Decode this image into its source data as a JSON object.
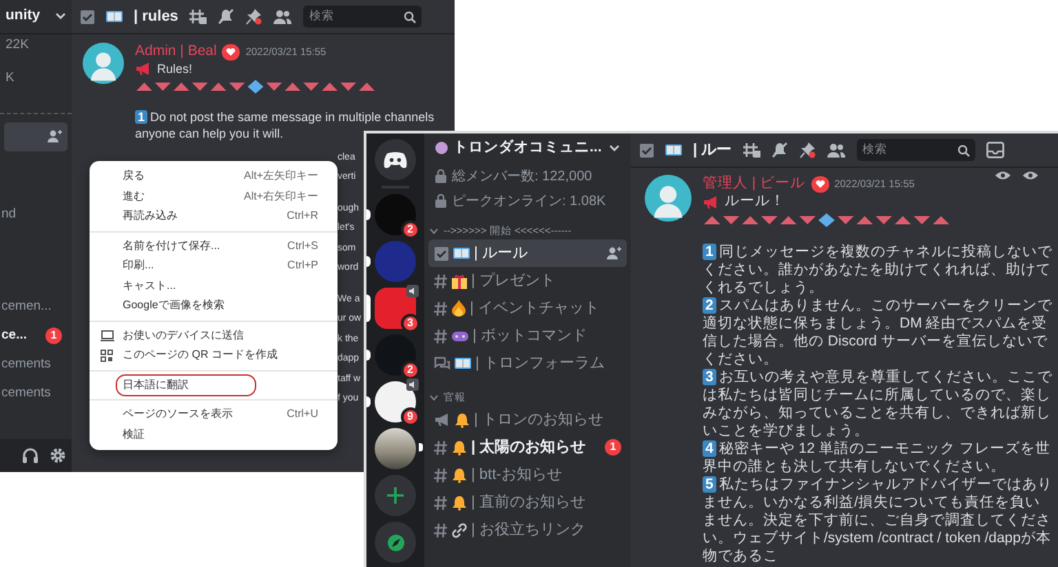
{
  "left_window": {
    "server_name": "unity",
    "stats": [
      "22K",
      "K"
    ],
    "channels": [
      {
        "selected": true,
        "unread": false
      },
      {
        "label": "nd",
        "selected": false,
        "unread": false
      },
      {
        "label": "cemen...",
        "selected": false,
        "unread": false
      },
      {
        "label": "ce...",
        "selected": false,
        "unread": true,
        "badge": "1"
      },
      {
        "label": "cements",
        "selected": false,
        "unread": false
      },
      {
        "label": "cements",
        "selected": false,
        "unread": false
      }
    ],
    "channel_name": "| rules",
    "search": {
      "placeholder": "検索"
    },
    "message": {
      "author": "Admin | Beal",
      "timestamp": "2022/03/21 15:55",
      "title": "Rules!",
      "rule": {
        "number": "1",
        "text": "Do not post the same message in multiple channels"
      },
      "continuation": "anyone can help you it will.",
      "fragments": [
        "clea",
        "verti",
        "ough",
        "let's",
        "som",
        "word",
        "We a",
        "ur ow",
        "k the",
        "dapp",
        "taff w",
        "f you"
      ]
    }
  },
  "context_menu": {
    "groups": [
      [
        {
          "label": "戻る",
          "shortcut": "Alt+左矢印キー",
          "highlighted": false
        },
        {
          "label": "進む",
          "shortcut": "Alt+右矢印キー",
          "highlighted": false
        },
        {
          "label": "再読み込み",
          "shortcut": "Ctrl+R",
          "highlighted": false
        }
      ],
      [
        {
          "label": "名前を付けて保存...",
          "shortcut": "Ctrl+S",
          "highlighted": false
        },
        {
          "label": "印刷...",
          "shortcut": "Ctrl+P",
          "highlighted": false
        },
        {
          "label": "キャスト...",
          "highlighted": false
        },
        {
          "label": "Googleで画像を検索",
          "highlighted": false
        }
      ],
      [
        {
          "label": "お使いのデバイスに送信",
          "kind": "send",
          "highlighted": false
        },
        {
          "label": "このページの QR コードを作成",
          "kind": "qr",
          "highlighted": false
        }
      ],
      [
        {
          "label": "日本語に翻訳",
          "highlighted": true
        }
      ],
      [
        {
          "label": "ページのソースを表示",
          "shortcut": "Ctrl+U",
          "highlighted": false
        },
        {
          "label": "検証",
          "highlighted": false
        }
      ]
    ]
  },
  "right_window": {
    "servers": [
      {
        "kind": "home",
        "selected": false,
        "unread": false
      },
      {
        "kind": "server",
        "color": "#0b0b0b",
        "badge": "2",
        "selected": false,
        "unread": true,
        "voice": false
      },
      {
        "kind": "server",
        "color": "#1e2a8c",
        "selected": false,
        "unread": true,
        "voice": false
      },
      {
        "kind": "server",
        "color": "#e3202c",
        "badge": "3",
        "selected": true,
        "unread": false,
        "voice": true
      },
      {
        "kind": "server",
        "color": "#101418",
        "badge": "2",
        "selected": false,
        "unread": true,
        "voice": false
      },
      {
        "kind": "server",
        "color": "#f2f2f2",
        "badge": "9",
        "selected": false,
        "unread": true,
        "voice": true
      },
      {
        "kind": "photo",
        "selected": false,
        "unread": false
      },
      {
        "kind": "add",
        "selected": false,
        "unread": false
      },
      {
        "kind": "explore",
        "selected": false,
        "unread": false
      }
    ],
    "server_name": "トロンダオコミュニ...",
    "stats": [
      "総メンバー数: 122,000",
      "ピークオンライン: 1.08K"
    ],
    "categories": [
      {
        "name": "-->>>>>> 開始 <<<<<<------",
        "channels": [
          {
            "kind": "rules",
            "name": "| ルール",
            "selected": true,
            "unread": false
          },
          {
            "kind": "gift",
            "name": "| プレゼント",
            "selected": false,
            "unread": false
          },
          {
            "kind": "fire",
            "name": "| イベントチャット",
            "selected": false,
            "unread": false
          },
          {
            "kind": "game",
            "name": "| ボットコマンド",
            "selected": false,
            "unread": false
          },
          {
            "kind": "forum",
            "name": "| トロンフォーラム",
            "selected": false,
            "unread": false
          }
        ]
      },
      {
        "name": "官報",
        "channels": [
          {
            "kind": "announce",
            "name": "| トロンのお知らせ",
            "selected": false,
            "unread": false
          },
          {
            "kind": "bell",
            "name": "| 太陽のお知らせ",
            "selected": false,
            "unread": true,
            "badge": "1"
          },
          {
            "kind": "bell",
            "name": "| btt-お知らせ",
            "selected": false,
            "unread": false
          },
          {
            "kind": "bell",
            "name": "| 直前のお知らせ",
            "selected": false,
            "unread": false
          },
          {
            "kind": "link",
            "name": "| お役立ちリンク",
            "selected": false,
            "unread": false
          }
        ]
      }
    ],
    "channel_name": "| ルー",
    "search": {
      "placeholder": "検索"
    },
    "message": {
      "author": "管理人 | ビール",
      "timestamp": "2022/03/21 15:55",
      "title": "ルール！",
      "rules": [
        {
          "number": "1",
          "text": "同じメッセージを複数のチャネルに投稿しないでください。誰かがあなたを助けてくれれば、助けてくれるでしょう。"
        },
        {
          "number": "2",
          "text": "スパムはありません。このサーバーをクリーンで適切な状態に保ちましょう。DM 経由でスパムを受信した場合。他の Discord サーバーを宣伝しないでください。"
        },
        {
          "number": "3",
          "text": "お互いの考えや意見を尊重してください。ここでは私たちは皆同じチームに所属しているので、楽しみながら、知っていることを共有し、できれば新しいことを学びましょう。"
        },
        {
          "number": "4",
          "text": "秘密キーや 12 単語のニーモニック フレーズを世界中の誰とも決して共有しないでください。"
        },
        {
          "number": "5",
          "text": "私たちはファイナンシャルアドバイザーではありません。いかなる利益/損失についても責任を負いません。決定を下す前に、ご自身で調査してください。ウェブサイト/system /contract / token /dappが本物であるこ"
        }
      ]
    }
  }
}
